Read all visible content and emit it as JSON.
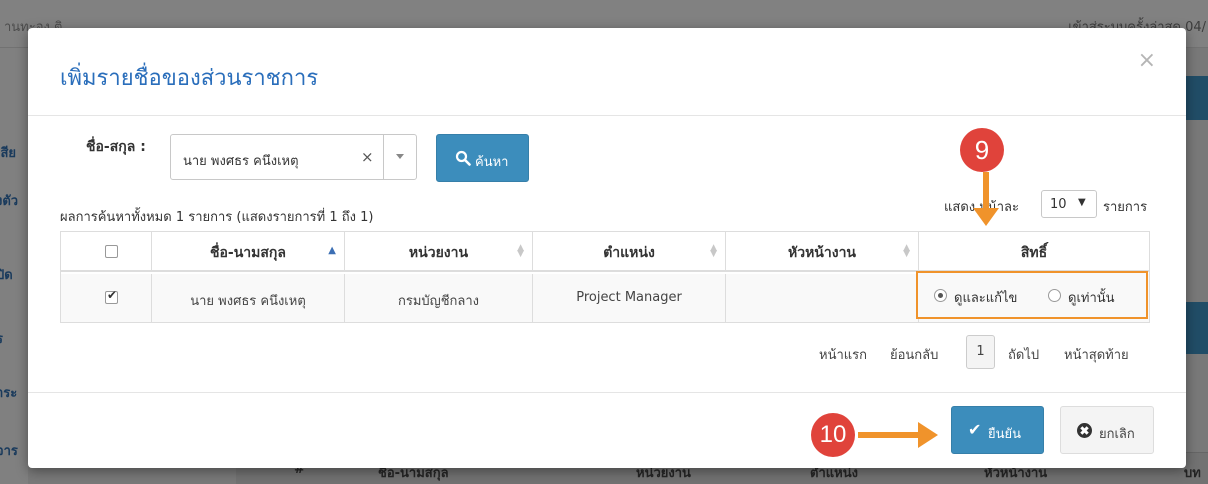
{
  "background": {
    "topbar_left": "านทะอง ติ",
    "topbar_right": "เข้าสู่ระบบครั้งล่าสุด 04/",
    "sidebar_items": [
      "เสีย",
      "งตัว",
      "ปิด",
      "ร",
      "าระ",
      "จาร"
    ],
    "table_headers": [
      "#",
      "ชื่อ-นามสกุล",
      "หน่วยงาน",
      "ตำแหน่ง",
      "หัวหน้างาน",
      "บท"
    ]
  },
  "modal": {
    "title": "เพิ่มรายชื่อของส่วนราชการ",
    "close_label": "×",
    "search": {
      "label": "ชื่อ-สกุล :",
      "selected_value": "นาย พงศธร คนึงเหตุ",
      "clear_label": "×",
      "button_label": "ค้นหา"
    },
    "result_summary": "ผลการค้นหาทั้งหมด 1 รายการ (แสดงรายการที่ 1 ถึง 1)",
    "page_length": {
      "prefix": "แสดง หน้าละ",
      "value": "10",
      "suffix": "รายการ"
    },
    "table": {
      "headers": [
        "ชื่อ-นามสกุล",
        "หน่วยงาน",
        "ตำแหน่ง",
        "หัวหน้างาน",
        "สิทธิ์"
      ],
      "rows": [
        {
          "checked": true,
          "name": "นาย พงศธร คนึงเหตุ",
          "department": "กรมบัญชีกลาง",
          "position": "Project Manager",
          "supervisor": "",
          "permission_options": [
            "ดูและแก้ไข",
            "ดูเท่านั้น"
          ],
          "permission_selected": "ดูและแก้ไข"
        }
      ]
    },
    "pagination": {
      "first": "หน้าแรก",
      "prev": "ย้อนกลับ",
      "current": "1",
      "next": "ถัดไป",
      "last": "หน้าสุดท้าย"
    },
    "footer": {
      "confirm_label": "ยืนยัน",
      "cancel_label": "ยกเลิก"
    }
  },
  "annotations": {
    "step_9": "9",
    "step_10": "10",
    "color": "#f0932b",
    "badge_color": "#e0433b"
  },
  "colors": {
    "primary": "#3c8dbc",
    "title": "#2a6ebb"
  }
}
